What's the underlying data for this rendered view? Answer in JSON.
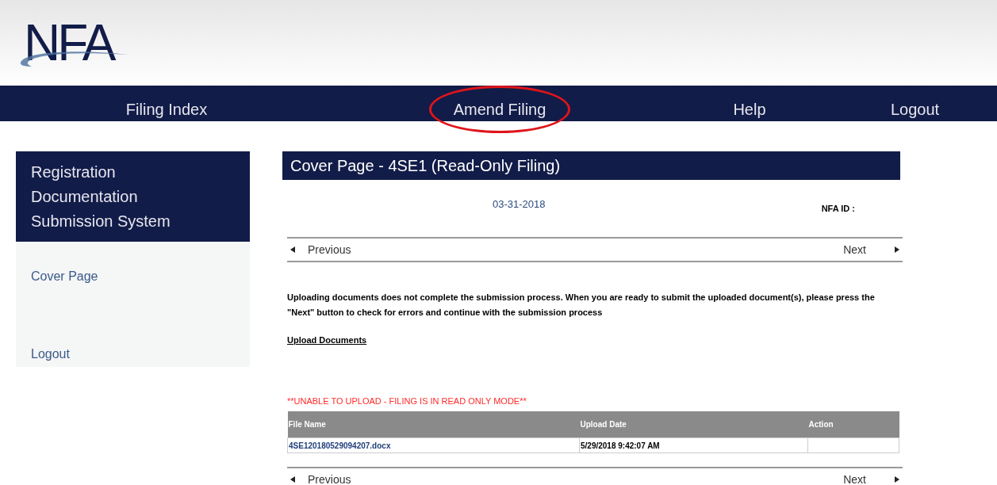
{
  "header": {
    "logo": "NFA"
  },
  "nav": [
    {
      "label": "Filing Index",
      "highlighted": false
    },
    {
      "label": "Amend Filing",
      "highlighted": true
    },
    {
      "label": "Help",
      "highlighted": false
    },
    {
      "label": "Logout",
      "highlighted": false
    }
  ],
  "sidebar": {
    "title": "Registration Documentation Submission System",
    "items": [
      "Cover Page",
      "Logout"
    ]
  },
  "main": {
    "title": "Cover Page - 4SE1 (Read-Only Filing)",
    "date": "03-31-2018",
    "nfa_id_label": "NFA ID :",
    "pager_top": {
      "previous": "Previous",
      "next": "Next"
    },
    "notice": "Uploading documents does not complete the submission process. When you are ready to submit the uploaded document(s), please press the \"Next\" button to check for errors and continue with the submission process",
    "upload_link": "Upload Documents",
    "warning": "**UNABLE TO UPLOAD - FILING IS IN READ ONLY MODE**",
    "table": {
      "columns": [
        "File Name",
        "Upload Date",
        "Action"
      ],
      "rows": [
        {
          "file": "4SE120180529094207.docx",
          "date": "5/29/2018 9:42:07 AM"
        }
      ]
    },
    "pager_bottom": {
      "previous": "Previous",
      "next": "Next"
    }
  }
}
